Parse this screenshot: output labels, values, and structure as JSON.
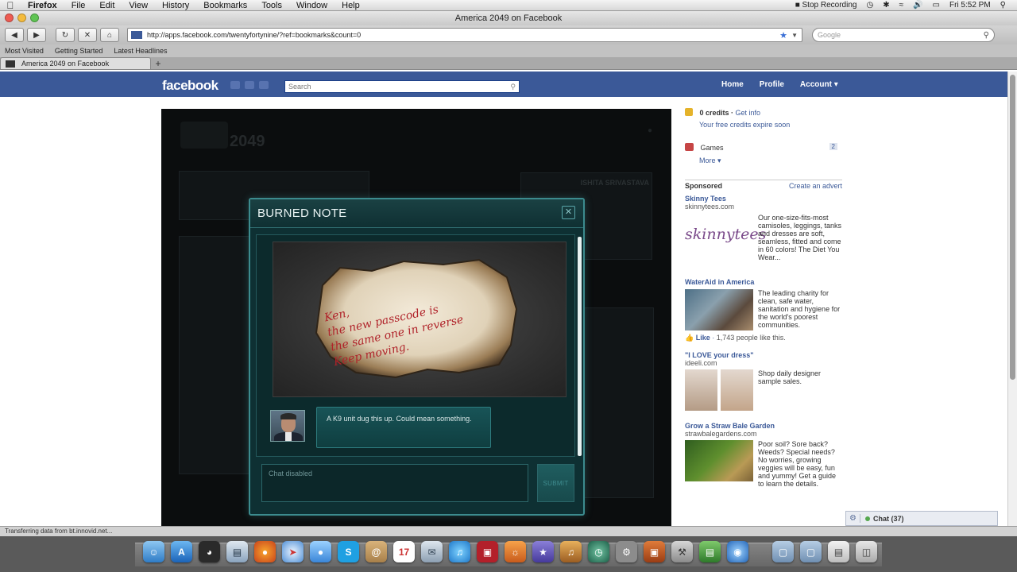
{
  "mac_menu": {
    "app": "Firefox",
    "items": [
      "File",
      "Edit",
      "View",
      "History",
      "Bookmarks",
      "Tools",
      "Window",
      "Help"
    ],
    "recording": "Stop Recording",
    "clock": "Fri 5:52 PM"
  },
  "window": {
    "title": "America 2049 on Facebook"
  },
  "nav": {
    "url": "http://apps.facebook.com/twentyfortynine/?ref=bookmarks&count=0",
    "search_placeholder": "Google"
  },
  "bookmarks": [
    "Most Visited",
    "Getting Started",
    "Latest Headlines"
  ],
  "tab": {
    "label": "America 2049 on Facebook"
  },
  "facebook": {
    "logo": "facebook",
    "search_placeholder": "Search",
    "nav": [
      "Home",
      "Profile",
      "Account"
    ]
  },
  "game": {
    "background_title": "2049",
    "background_name": "ISHITA SRIVASTAVA",
    "modal": {
      "title": "BURNED NOTE",
      "note_text": "Ken,\nthe new passcode is\nthe same one in reverse\nKeep moving.",
      "message": "A K9 unit dug this up. Could mean something.",
      "chat_placeholder": "Chat disabled",
      "submit": "SUBMIT"
    }
  },
  "sidebar": {
    "credits": "0 credits",
    "get_info": "Get info",
    "credits_note": "Your free credits expire soon",
    "games": "Games",
    "games_count": "2",
    "more": "More",
    "sponsored": "Sponsored",
    "create_advert": "Create an advert",
    "ads": [
      {
        "title": "Skinny Tees",
        "domain": "skinnytees.com",
        "logo": "skinnytees",
        "text": "Our one-size-fits-most camisoles, leggings, tanks and dresses are soft, seamless, fitted and come in 60 colors! The Diet You Wear..."
      },
      {
        "title": "WaterAid in America",
        "domain": "",
        "text": "The leading charity for clean, safe water, sanitation and hygiene for the world's poorest communities.",
        "like": "Like",
        "like_count": "1,743 people like this."
      },
      {
        "title": "\"I LOVE your dress\"",
        "domain": "ideeli.com",
        "text": "Shop daily designer sample sales."
      },
      {
        "title": "Grow a Straw Bale Garden",
        "domain": "strawbalegardens.com",
        "text": "Poor soil? Sore back? Weeds? Special needs? No worries, growing veggies will be easy, fun and yummy! Get a guide to learn the details."
      }
    ]
  },
  "chat": {
    "label": "Chat (37)"
  },
  "status": "Transferring data from bt.innovid.net...",
  "colors": {
    "facebook_blue": "#3b5998",
    "modal_teal": "#0e3033",
    "note_ink": "#b0232a"
  }
}
